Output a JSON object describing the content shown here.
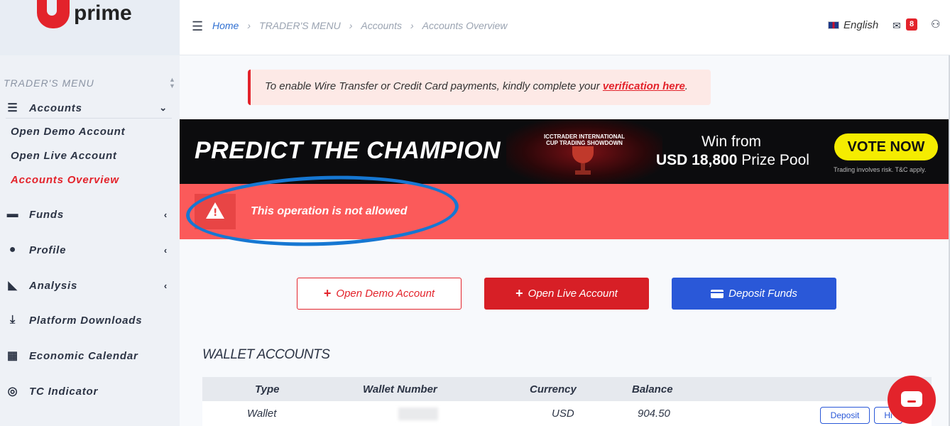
{
  "brand": {
    "logo_text": "prime"
  },
  "sidebar": {
    "heading": "TRADER'S MENU",
    "accounts": {
      "label": "Accounts",
      "icon": "list-icon"
    },
    "sub_items": [
      {
        "label": "Open Demo Account",
        "active": false
      },
      {
        "label": "Open Live Account",
        "active": false
      },
      {
        "label": "Accounts Overview",
        "active": true
      }
    ],
    "items": [
      {
        "label": "Funds",
        "icon": "wallet-icon",
        "expandable": true
      },
      {
        "label": "Profile",
        "icon": "user-icon",
        "expandable": true
      },
      {
        "label": "Analysis",
        "icon": "chart-icon",
        "expandable": true
      },
      {
        "label": "Platform Downloads",
        "icon": "download-icon",
        "expandable": false
      },
      {
        "label": "Economic Calendar",
        "icon": "calendar-icon",
        "expandable": false
      },
      {
        "label": "TC Indicator",
        "icon": "target-icon",
        "expandable": false
      }
    ]
  },
  "header": {
    "breadcrumb": [
      "Home",
      "TRADER'S MENU",
      "Accounts",
      "Accounts Overview"
    ],
    "language": "English",
    "mail_count": "8"
  },
  "notice": {
    "text": "To enable Wire Transfer or Credit Card payments, kindly complete your ",
    "link": "verification here",
    "end": "."
  },
  "banner": {
    "title": "PREDICT THE CHAMPION",
    "cup_title": "ICCTRADER INTERNATIONAL CUP TRADING SHOWDOWN",
    "win_line1": "Win from",
    "win_amount": "USD 18,800",
    "win_rest": " Prize Pool",
    "cta": "VOTE NOW",
    "disclaimer": "Trading involves risk. T&C apply."
  },
  "error": {
    "message": "This operation is not allowed"
  },
  "actions": {
    "demo": "Open Demo Account",
    "live": "Open Live Account",
    "deposit": "Deposit Funds"
  },
  "wallet": {
    "title": "WALLET ACCOUNTS",
    "columns": [
      "Type",
      "Wallet Number",
      "Currency",
      "Balance"
    ],
    "rows": [
      {
        "type": "Wallet",
        "number": "",
        "currency": "USD",
        "balance": "904.50",
        "deposit": "Deposit",
        "history": "Hi"
      }
    ]
  },
  "colors": {
    "brand_red": "#e3232b",
    "error_bg": "#fb5a5a",
    "deposit_blue": "#2a58d8",
    "annotation_blue": "#1677d2"
  }
}
